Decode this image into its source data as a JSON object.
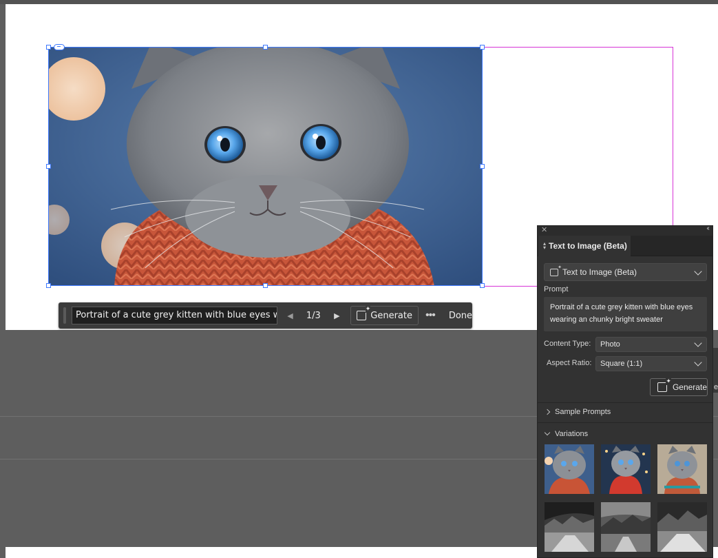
{
  "taskbar": {
    "prompt_value": "Portrait of a cute grey kitten with blue eyes wearin",
    "pager": "1/3",
    "generate_label": "Generate",
    "more_label": "•••",
    "done_label": "Done"
  },
  "panel": {
    "tab_label": "Text to Image (Beta)",
    "feature_select": "Text to Image (Beta)",
    "prompt_label": "Prompt",
    "prompt_text": "Portrait of a cute grey kitten with blue eyes wearing an chunky bright sweater",
    "content_type_label": "Content Type:",
    "content_type_value": "Photo",
    "aspect_ratio_label": "Aspect Ratio:",
    "aspect_ratio_value": "Square (1:1)",
    "generate_label": "Generate",
    "sample_prompts_label": "Sample Prompts",
    "variations_label": "Variations"
  },
  "colors": {
    "selection": "#3c78ff",
    "text_frame": "#d633d6",
    "panel_bg": "#323232",
    "pasteboard": "#5e5e5e"
  },
  "edge_text": "er"
}
